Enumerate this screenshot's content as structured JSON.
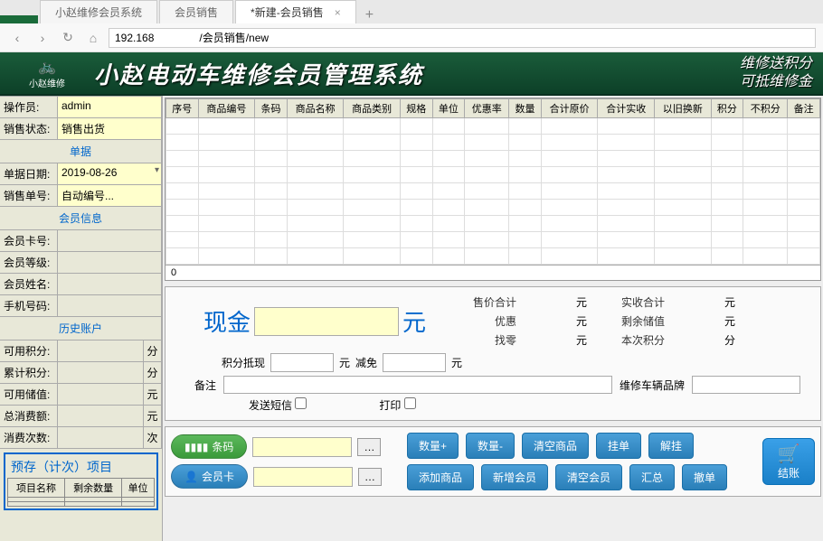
{
  "tabs": {
    "t0": "",
    "t1": "小赵维修会员系统",
    "t2": "会员销售",
    "t3": "*新建-会员销售"
  },
  "url": "192.168               /会员销售/new",
  "header": {
    "logo_text": "小赵维修",
    "title": "小赵电动车维修会员管理系统",
    "sub1": "维修送积分",
    "sub2": "可抵维修金"
  },
  "sidebar": {
    "operator_lbl": "操作员:",
    "operator_val": "admin",
    "salestate_lbl": "销售状态:",
    "salestate_val": "销售出货",
    "sec_bill": "单据",
    "billdate_lbl": "单据日期:",
    "billdate_val": "2019-08-26",
    "billno_lbl": "销售单号:",
    "billno_val": "自动编号...",
    "sec_member": "会员信息",
    "cardno_lbl": "会员卡号:",
    "level_lbl": "会员等级:",
    "name_lbl": "会员姓名:",
    "phone_lbl": "手机号码:",
    "sec_history": "历史账户",
    "avail_pts_lbl": "可用积分:",
    "unit_pts": "分",
    "acc_pts_lbl": "累计积分:",
    "avail_store_lbl": "可用储值:",
    "unit_yuan": "元",
    "total_spend_lbl": "总消费额:",
    "spend_count_lbl": "消费次数:",
    "unit_times": "次"
  },
  "prestore": {
    "title": "预存（计次）项目",
    "col1": "项目名称",
    "col2": "剩余数量",
    "col3": "单位"
  },
  "grid": {
    "cols": [
      "序号",
      "商品编号",
      "条码",
      "商品名称",
      "商品类别",
      "规格",
      "单位",
      "优惠率",
      "数量",
      "合计原价",
      "合计实收",
      "以旧换新",
      "积分",
      "不积分",
      "备注"
    ],
    "footer": "0"
  },
  "pay": {
    "cash_lbl": "现金",
    "cash_unit": "元",
    "sale_total": "售价合计",
    "recv_total": "实收合计",
    "discount": "优惠",
    "remain_store": "剩余储值",
    "change": "找零",
    "this_pts": "本次积分",
    "pts_deduct": "积分抵现",
    "minus": "减免",
    "yuan": "元",
    "fen": "分",
    "remark": "备注",
    "vehicle_brand": "维修车辆品牌",
    "sms": "发送短信",
    "print": "打印"
  },
  "btns": {
    "barcode": "条码",
    "member_card": "会员卡",
    "qty_plus": "数量+",
    "qty_minus": "数量-",
    "clear_goods": "清空商品",
    "hold": "挂单",
    "unhold": "解挂",
    "add_goods": "添加商品",
    "add_member": "新增会员",
    "clear_member": "清空会员",
    "summary": "汇总",
    "revoke": "撤单",
    "checkout": "结账"
  }
}
